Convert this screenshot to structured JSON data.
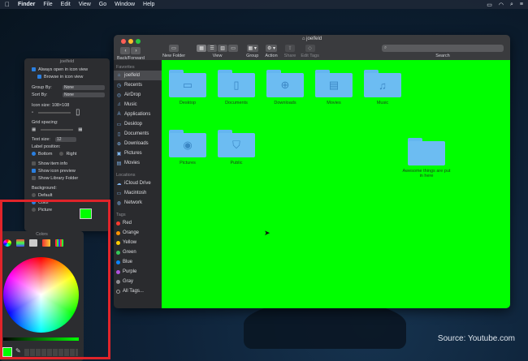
{
  "menubar": {
    "apple": "",
    "app": "Finder",
    "items": [
      "File",
      "Edit",
      "View",
      "Go",
      "Window",
      "Help"
    ]
  },
  "finder": {
    "title": "joelfeld",
    "toolbar": {
      "back_forward": "Back/Forward",
      "new_folder": "New Folder",
      "view": "View",
      "group": "Group",
      "action": "Action",
      "share": "Share",
      "edit_tags": "Edit Tags",
      "search": "Search"
    },
    "sidebar": {
      "favorites_header": "Favorites",
      "favorites": [
        "joelfeld",
        "Recents",
        "AirDrop",
        "Music",
        "Applications",
        "Desktop",
        "Documents",
        "Downloads",
        "Pictures",
        "Movies"
      ],
      "locations_header": "Locations",
      "locations": [
        "iCloud Drive",
        "Macintosh",
        "Network"
      ],
      "tags_header": "Tags",
      "tags": [
        {
          "label": "Red",
          "color": "#ff3b30"
        },
        {
          "label": "Orange",
          "color": "#ff9500"
        },
        {
          "label": "Yellow",
          "color": "#ffcc00"
        },
        {
          "label": "Green",
          "color": "#34c759"
        },
        {
          "label": "Blue",
          "color": "#0a84ff"
        },
        {
          "label": "Purple",
          "color": "#af52de"
        },
        {
          "label": "Gray",
          "color": "#8e8e93"
        },
        {
          "label": "All Tags...",
          "color": ""
        }
      ]
    },
    "folders": [
      {
        "label": "Desktop",
        "icon": "desktop-icon"
      },
      {
        "label": "Documents",
        "icon": "documents-icon"
      },
      {
        "label": "Downloads",
        "icon": "downloads-icon"
      },
      {
        "label": "Movies",
        "icon": "movies-icon"
      },
      {
        "label": "Music",
        "icon": "music-icon"
      },
      {
        "label": "Pictures",
        "icon": "pictures-icon"
      },
      {
        "label": "Public",
        "icon": "public-icon"
      },
      {
        "label": "Awesome things are put in here",
        "icon": "folder-icon"
      }
    ],
    "background_color": "#00ff00"
  },
  "view_options": {
    "title": "joelfeld",
    "always_open": "Always open in icon view",
    "browse_in": "Browse in icon view",
    "group_by_label": "Group By:",
    "group_by_value": "None",
    "sort_by_label": "Sort By:",
    "sort_by_value": "None",
    "icon_size": "Icon size: 108×108",
    "grid_spacing": "Grid spacing:",
    "text_size_label": "Text size:",
    "text_size_value": "12",
    "label_position": "Label position:",
    "bottom": "Bottom",
    "right": "Right",
    "show_item_info": "Show item info",
    "show_icon_preview": "Show icon preview",
    "show_library": "Show Library Folder",
    "background_label": "Background:",
    "bg_default": "Default",
    "bg_color": "Color",
    "bg_picture": "Picture"
  },
  "colors_panel": {
    "title": "Colors"
  },
  "source": "Source: Youtube.com"
}
